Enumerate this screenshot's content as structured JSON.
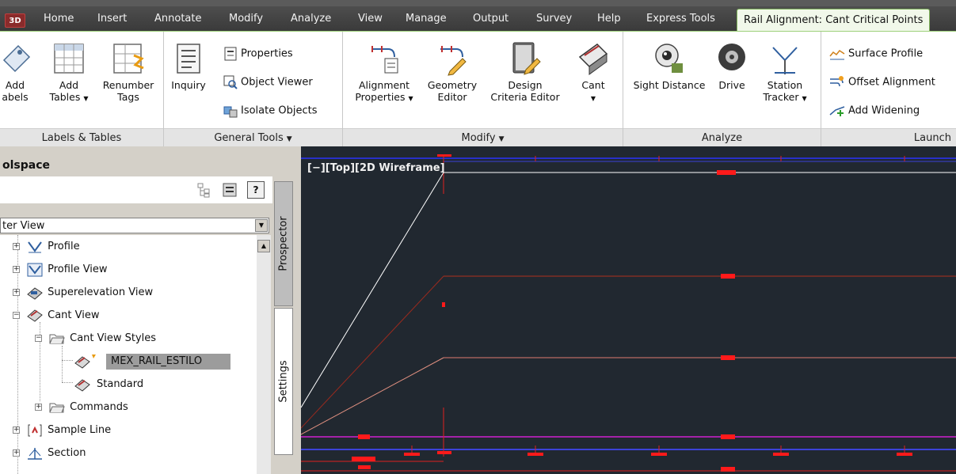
{
  "app": {
    "badge": "3D"
  },
  "ribbon_tabs": [
    "Home",
    "Insert",
    "Annotate",
    "Modify",
    "Analyze",
    "View",
    "Manage",
    "Output",
    "Survey",
    "Help",
    "Express Tools",
    "Rail Alignment: Cant Critical Points"
  ],
  "panels": {
    "labels_tables": {
      "title": "Labels & Tables",
      "add_labels": [
        "Add",
        "abels"
      ],
      "add_tables": [
        "Add",
        "Tables"
      ],
      "renumber_tags": [
        "Renumber",
        "Tags"
      ]
    },
    "general_tools": {
      "title": "General Tools",
      "inquiry": "Inquiry",
      "properties": "Properties",
      "object_viewer": "Object Viewer",
      "isolate_objects": "Isolate Objects"
    },
    "modify": {
      "title": "Modify",
      "alignment_properties": [
        "Alignment",
        "Properties"
      ],
      "geometry_editor": [
        "Geometry",
        "Editor"
      ],
      "design_criteria_editor": [
        "Design",
        "Criteria Editor"
      ],
      "cant": "Cant"
    },
    "analyze": {
      "title": "Analyze",
      "sight_distance": "Sight Distance",
      "drive": "Drive",
      "station_tracker": [
        "Station",
        "Tracker"
      ]
    },
    "launch": {
      "title": "Launch",
      "surface_profile": "Surface Profile",
      "offset_alignment": "Offset Alignment",
      "add_widening": "Add Widening"
    }
  },
  "toolspace": {
    "title": "olspace",
    "view_select": "ter View",
    "side_tabs": [
      "Prospector",
      "Settings"
    ],
    "tree": [
      {
        "label": "Profile",
        "icon": "profile-icon"
      },
      {
        "label": "Profile View",
        "icon": "profile-view-icon"
      },
      {
        "label": "Superelevation View",
        "icon": "superelevation-view-icon"
      },
      {
        "label": "Cant View",
        "icon": "cant-view-icon"
      },
      {
        "label": "Cant View Styles",
        "icon": "folder-icon"
      },
      {
        "label": "MEX_RAIL_ESTILO",
        "icon": "style-icon"
      },
      {
        "label": "Standard",
        "icon": "style-icon"
      },
      {
        "label": "Commands",
        "icon": "folder-icon"
      },
      {
        "label": "Sample Line",
        "icon": "sample-line-icon"
      },
      {
        "label": "Section",
        "icon": "section-icon"
      }
    ]
  },
  "viewport": {
    "label": "[−][Top][2D Wireframe]"
  },
  "colors": {
    "viewport_bg": "#212830",
    "active_tab_bg": "#f1f8ea",
    "selection": "#9c9c9c"
  }
}
